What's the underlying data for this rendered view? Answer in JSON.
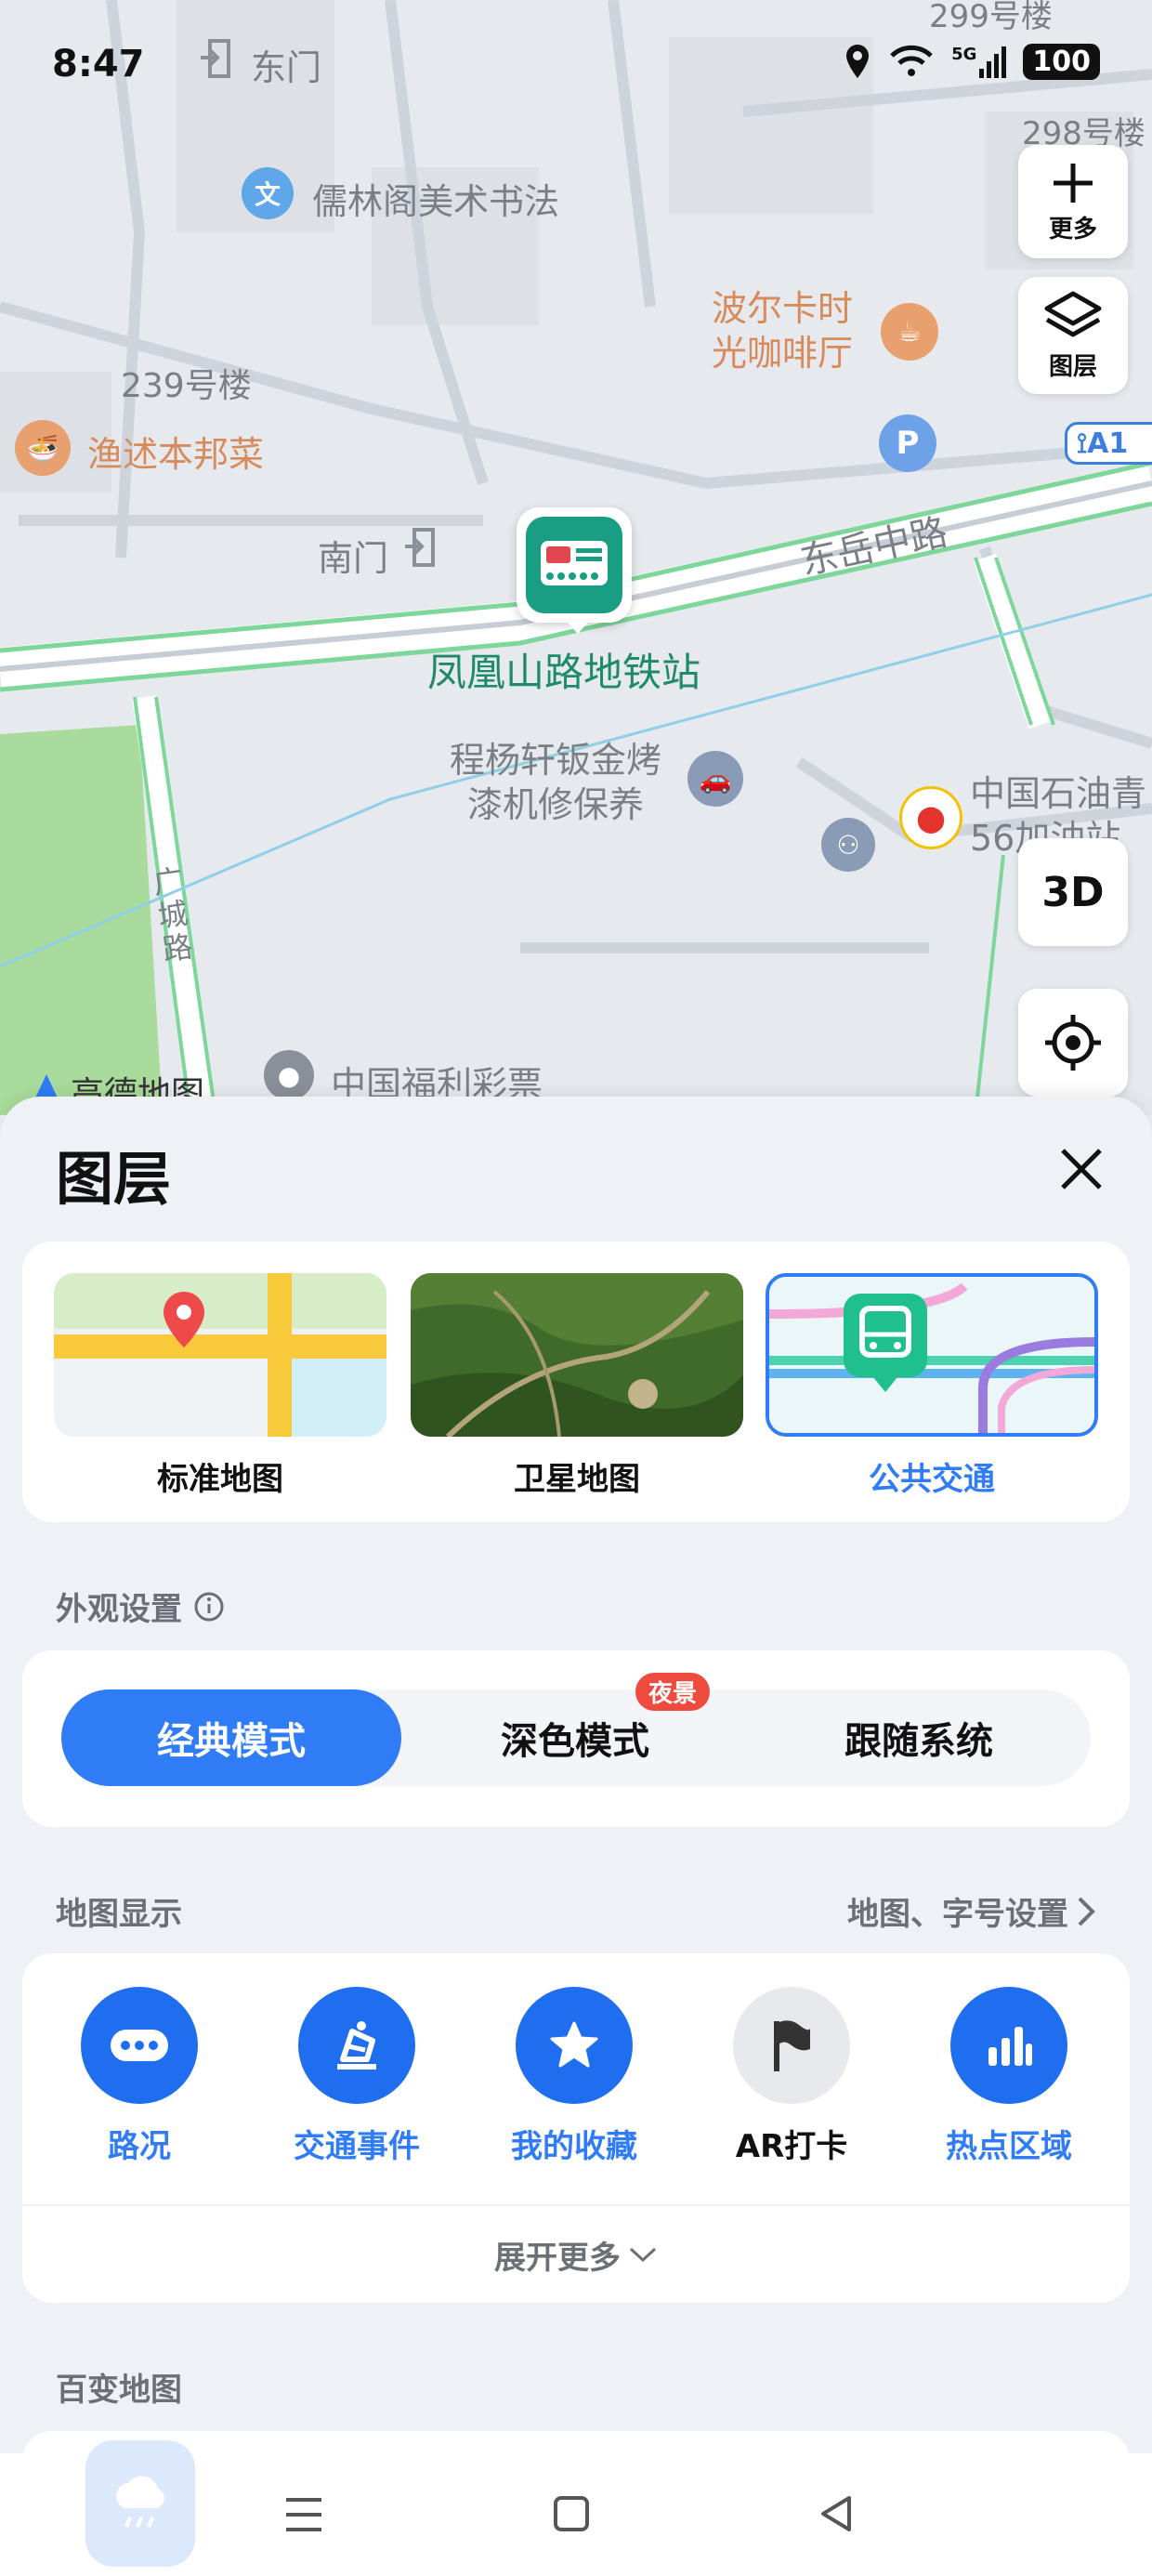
{
  "status_bar": {
    "time": "8:47",
    "battery": "100",
    "network": "5G"
  },
  "map": {
    "labels": {
      "dongmen": "东门",
      "gallery": "儒林阁美术书法",
      "bldg_299": "299号楼",
      "bldg_298": "298号楼",
      "cafe": "波尔卡时光咖啡厅",
      "bldg_239": "239号楼",
      "restaurant": "渔述本邦菜",
      "nanmen": "南门",
      "road_dongyue": "东岳中路",
      "station": "凤凰山路地铁站",
      "repair": "程杨轩钣金烤漆机修保养",
      "gas": "中国石油青56加油站",
      "road_guangcheng": "广城路",
      "lottery": "中国福利彩票",
      "brand": "高德地图",
      "exit_a1": "A1"
    },
    "buttons": {
      "more": "更多",
      "layers": "图层",
      "three_d": "3D"
    }
  },
  "sheet": {
    "title": "图层",
    "map_types": [
      {
        "label": "标准地图",
        "selected": false
      },
      {
        "label": "卫星地图",
        "selected": false
      },
      {
        "label": "公共交通",
        "selected": true
      }
    ],
    "appearance": {
      "label": "外观设置",
      "modes": [
        "经典模式",
        "深色模式",
        "跟随系统"
      ],
      "active": "经典模式",
      "badge": "夜景"
    },
    "display": {
      "label": "地图显示",
      "link": "地图、字号设置",
      "items": [
        {
          "label": "路况",
          "icon": "traffic-icon",
          "active": true
        },
        {
          "label": "交通事件",
          "icon": "traffic-event-icon",
          "active": true
        },
        {
          "label": "我的收藏",
          "icon": "star-icon",
          "active": true
        },
        {
          "label": "AR打卡",
          "icon": "flag-icon",
          "active": false
        },
        {
          "label": "热点区域",
          "icon": "bar-chart-icon",
          "active": true
        }
      ],
      "expand": "展开更多"
    },
    "variety": {
      "label": "百变地图"
    }
  },
  "colors": {
    "accent": "#2f7cf6",
    "active_circle": "#1f6ef0",
    "badge": "#ee4a3e"
  }
}
